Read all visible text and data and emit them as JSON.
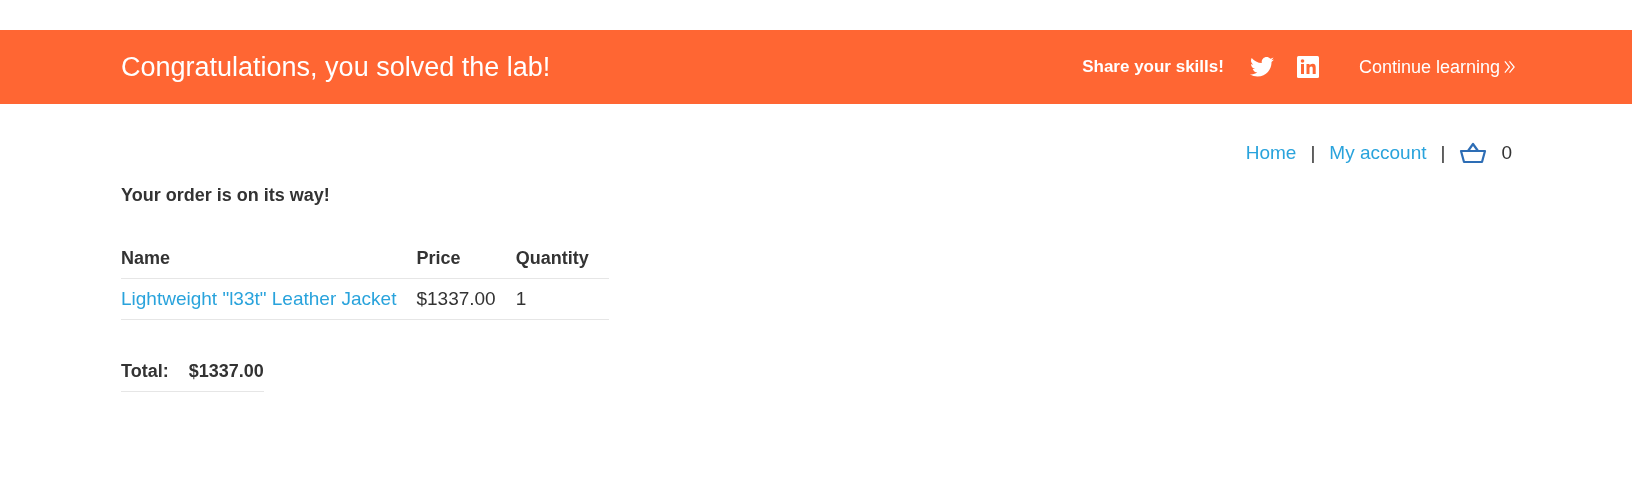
{
  "banner": {
    "title": "Congratulations, you solved the lab!",
    "share_label": "Share your skills!",
    "continue_link": "Continue learning"
  },
  "nav": {
    "links": [
      {
        "label": "Home",
        "separator": "|"
      },
      {
        "label": "My account",
        "separator": "|"
      }
    ],
    "cart_count": "0"
  },
  "heading": "Your order is on its way!",
  "table": {
    "columns": [
      "Name",
      "Price",
      "Quantity"
    ],
    "rows": [
      {
        "name": "Lightweight \"l33t\" Leather Jacket",
        "price": "$1337.00",
        "quantity": "1"
      }
    ]
  },
  "total": {
    "label": "Total:",
    "value": "$1337.00"
  }
}
